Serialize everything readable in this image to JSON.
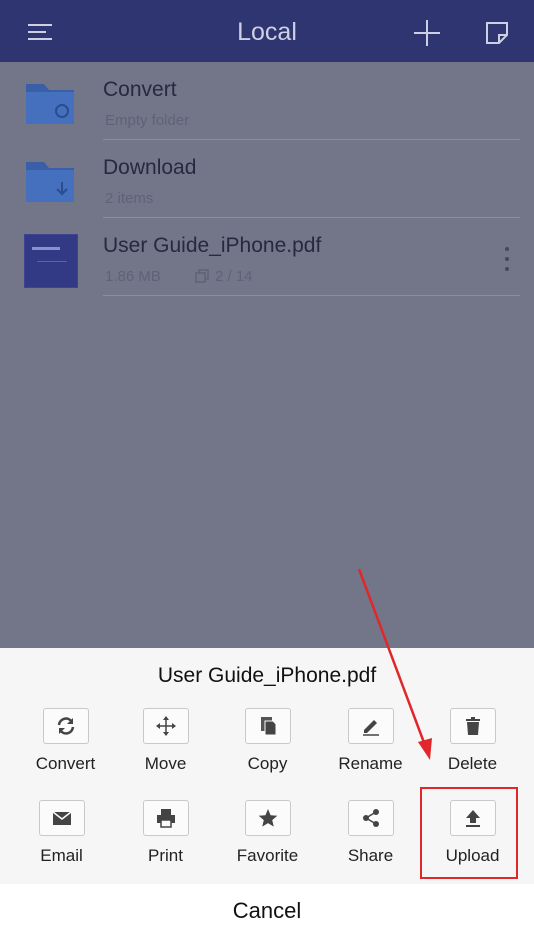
{
  "header": {
    "title": "Local",
    "menu_icon": "hamburger-menu-icon",
    "add_icon": "plus-icon",
    "edit_icon": "note-edit-icon"
  },
  "files": [
    {
      "name": "Convert",
      "meta": "Empty folder",
      "icon": "folder-sync-icon"
    },
    {
      "name": "Download",
      "meta": "2 items",
      "icon": "folder-download-icon"
    },
    {
      "name": "User Guide_iPhone.pdf",
      "size": "1.86 MB",
      "pages": "2 / 14",
      "icon": "pdf-thumbnail",
      "more_icon": "more-vertical-icon"
    }
  ],
  "sheet": {
    "title": "User Guide_iPhone.pdf",
    "actions": [
      {
        "label": "Convert",
        "icon": "convert-icon"
      },
      {
        "label": "Move",
        "icon": "move-icon"
      },
      {
        "label": "Copy",
        "icon": "copy-icon"
      },
      {
        "label": "Rename",
        "icon": "rename-icon"
      },
      {
        "label": "Delete",
        "icon": "trash-icon"
      },
      {
        "label": "Email",
        "icon": "email-icon"
      },
      {
        "label": "Print",
        "icon": "print-icon"
      },
      {
        "label": "Favorite",
        "icon": "star-icon"
      },
      {
        "label": "Share",
        "icon": "share-icon"
      },
      {
        "label": "Upload",
        "icon": "upload-icon"
      }
    ],
    "cancel": "Cancel"
  },
  "colors": {
    "header_bg": "#2f3570",
    "overlay_bg": "#737688",
    "sheet_bg": "#f6f6f6",
    "highlight": "#e0272b"
  }
}
